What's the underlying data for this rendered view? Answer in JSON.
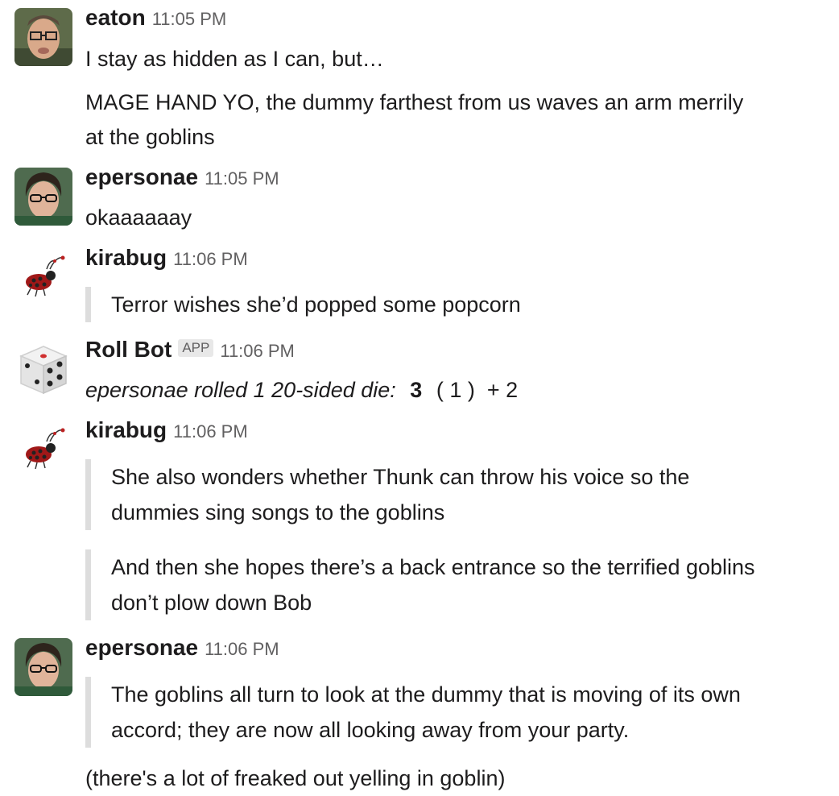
{
  "messages": [
    {
      "user": "eaton",
      "time": "11:05 PM",
      "lines": [
        "I stay as hidden as I can, but…",
        "MAGE HAND YO, the dummy farthest from us waves an arm merrily",
        "at the goblins"
      ]
    },
    {
      "user": "epersonae",
      "time": "11:05 PM",
      "lines": [
        "okaaaaaay"
      ]
    },
    {
      "user": "kirabug",
      "time": "11:06 PM",
      "quote": "Terror wishes she’d popped some popcorn"
    },
    {
      "user": "Roll Bot",
      "badge": "APP",
      "time": "11:06 PM",
      "roll_text": "epersonae rolled 1 20-sided die:",
      "roll_total": "3",
      "roll_detail": "( 1 )  + 2"
    },
    {
      "user": "kirabug",
      "time": "11:06 PM",
      "quotes": [
        [
          "She also wonders whether Thunk can throw his voice so the",
          "dummies sing songs to the goblins"
        ],
        [
          "And then she hopes there’s a back entrance so the terrified goblins",
          "don’t plow down Bob"
        ]
      ]
    },
    {
      "user": "epersonae",
      "time": "11:06 PM",
      "quote_lines": [
        "The goblins all turn to look at the dummy that is moving of its own",
        "accord; they are now all looking away from your party."
      ],
      "after": "(there's a lot of freaked out yelling in goblin)"
    }
  ]
}
